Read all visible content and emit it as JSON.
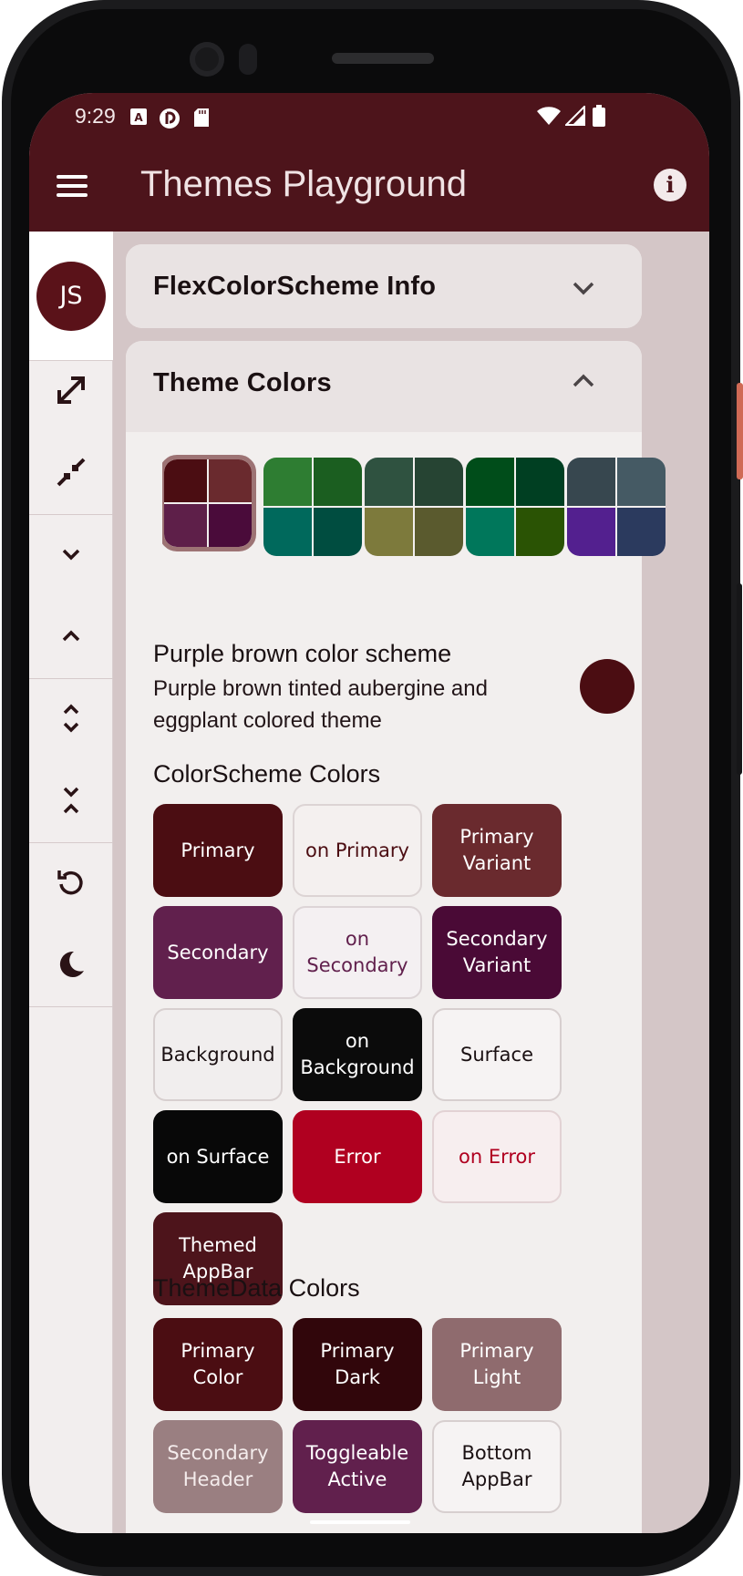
{
  "status_bar": {
    "time": "9:29",
    "left_icons": [
      "accessibility-icon",
      "daydream-icon",
      "sd-card-icon"
    ],
    "right_icons": [
      "wifi-icon",
      "signal-icon",
      "battery-icon"
    ]
  },
  "app_bar": {
    "title": "Themes Playground",
    "menu_icon": "menu-icon",
    "info_icon": "info-icon"
  },
  "nav_rail": {
    "avatar": "JS",
    "buttons": [
      {
        "name": "expand-all-icon"
      },
      {
        "name": "collapse-all-icon"
      },
      {
        "name": "chevron-down-icon"
      },
      {
        "name": "chevron-up-icon"
      },
      {
        "name": "unfold-more-icon"
      },
      {
        "name": "unfold-less-icon"
      },
      {
        "name": "reset-icon"
      },
      {
        "name": "dark-mode-icon"
      }
    ]
  },
  "panels": {
    "info": {
      "title": "FlexColorScheme Info",
      "expanded": false
    },
    "colors": {
      "title": "Theme Colors",
      "expanded": true
    }
  },
  "schemes": [
    {
      "selected": true,
      "colors": [
        "#4b0d12",
        "#6a2a2e",
        "#5e1f49",
        "#4a0b3a"
      ]
    },
    {
      "selected": false,
      "colors": [
        "#2e7d32",
        "#1b5e20",
        "#00695c",
        "#004d40"
      ]
    },
    {
      "selected": false,
      "colors": [
        "#2f5240",
        "#264433",
        "#7d7a3c",
        "#5a5a2e"
      ]
    },
    {
      "selected": false,
      "colors": [
        "#004d1a",
        "#003f22",
        "#00775b",
        "#2a5304"
      ]
    },
    {
      "selected": false,
      "colors": [
        "#37474f",
        "#455a64",
        "#53208f",
        "#2b3a5e"
      ]
    }
  ],
  "selected_scheme": {
    "name": "Purple brown color scheme",
    "description": "Purple brown tinted aubergine and eggplant colored theme",
    "color": "#4b0d12"
  },
  "colorscheme_section": {
    "title": "ColorScheme Colors",
    "tiles": [
      {
        "label": "Primary",
        "bg": "#4b0d12",
        "fg": "#ffffff",
        "border": ""
      },
      {
        "label": "on Primary",
        "bg": "#f4f0ef",
        "fg": "#4b0d12",
        "border": "#dcd4d4"
      },
      {
        "label": "Primary Variant",
        "bg": "#6a2a2e",
        "fg": "#ffffff",
        "border": ""
      },
      {
        "label": "Secondary",
        "bg": "#61204d",
        "fg": "#ffffff",
        "border": ""
      },
      {
        "label": "on Secondary",
        "bg": "#f4f0f2",
        "fg": "#61204d",
        "border": "#dcd4d6"
      },
      {
        "label": "Secondary Variant",
        "bg": "#4a0a36",
        "fg": "#ffffff",
        "border": ""
      },
      {
        "label": "Background",
        "bg": "#f1eeee",
        "fg": "#1a1012",
        "border": "#d7cfcf"
      },
      {
        "label": "on Background",
        "bg": "#0b0b0b",
        "fg": "#ffffff",
        "border": ""
      },
      {
        "label": "Surface",
        "bg": "#f6f3f3",
        "fg": "#1a1012",
        "border": "#d7cfcf"
      },
      {
        "label": "on Surface",
        "bg": "#080808",
        "fg": "#ffffff",
        "border": ""
      },
      {
        "label": "Error",
        "bg": "#b00020",
        "fg": "#ffffff",
        "border": ""
      },
      {
        "label": "on Error",
        "bg": "#f7eeef",
        "fg": "#b00020",
        "border": "#e2d2d4"
      },
      {
        "label": "Themed AppBar",
        "bg": "#4d141b",
        "fg": "#ffffff",
        "border": ""
      }
    ]
  },
  "themedata_section": {
    "title": "ThemeData Colors",
    "tiles": [
      {
        "label": "Primary Color",
        "bg": "#4b0d12",
        "fg": "#ffffff",
        "border": ""
      },
      {
        "label": "Primary Dark",
        "bg": "#31060b",
        "fg": "#ffffff",
        "border": ""
      },
      {
        "label": "Primary Light",
        "bg": "#8f6b6e",
        "fg": "#ffffff",
        "border": ""
      },
      {
        "label": "Secondary Header",
        "bg": "#9a7f81",
        "fg": "#f4ecec",
        "border": ""
      },
      {
        "label": "Toggleable Active",
        "bg": "#61204d",
        "fg": "#ffffff",
        "border": ""
      },
      {
        "label": "Bottom AppBar",
        "bg": "#f6f3f3",
        "fg": "#1a1012",
        "border": "#d7cfcf"
      }
    ]
  }
}
